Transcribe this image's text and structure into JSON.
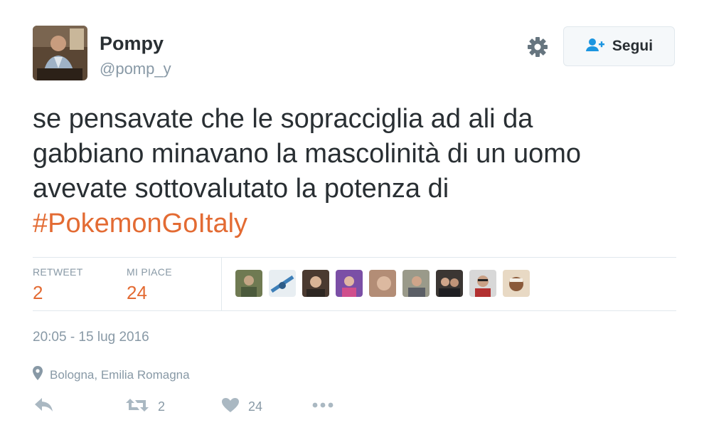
{
  "user": {
    "display_name": "Pompy",
    "handle": "@pomp_y"
  },
  "header": {
    "settings_icon": "gear-icon",
    "follow_icon": "add-user-icon",
    "follow_label": "Segui"
  },
  "tweet": {
    "text_lines": [
      "se pensavate che le sopracciglia ad ali da",
      "gabbiano minavano la mascolinità di un uomo",
      "avevate sottovalutato la potenza di"
    ],
    "hashtag": "#PokemonGoItaly"
  },
  "stats": {
    "retweets_label": "RETWEET",
    "retweets_count": "2",
    "likes_label": "MI PIACE",
    "likes_count": "24"
  },
  "meta": {
    "timestamp": "20:05 - 15 lug 2016",
    "location": "Bologna, Emilia Romagna"
  },
  "actions": {
    "reply_icon": "reply-icon",
    "retweet_icon": "retweet-icon",
    "retweet_count": "2",
    "like_icon": "heart-icon",
    "like_count": "24",
    "more_icon": "more-dots-icon"
  },
  "colors": {
    "accent": "#e36b33",
    "text": "#292f33",
    "muted": "#8899a6",
    "border": "#e1e8ed"
  }
}
